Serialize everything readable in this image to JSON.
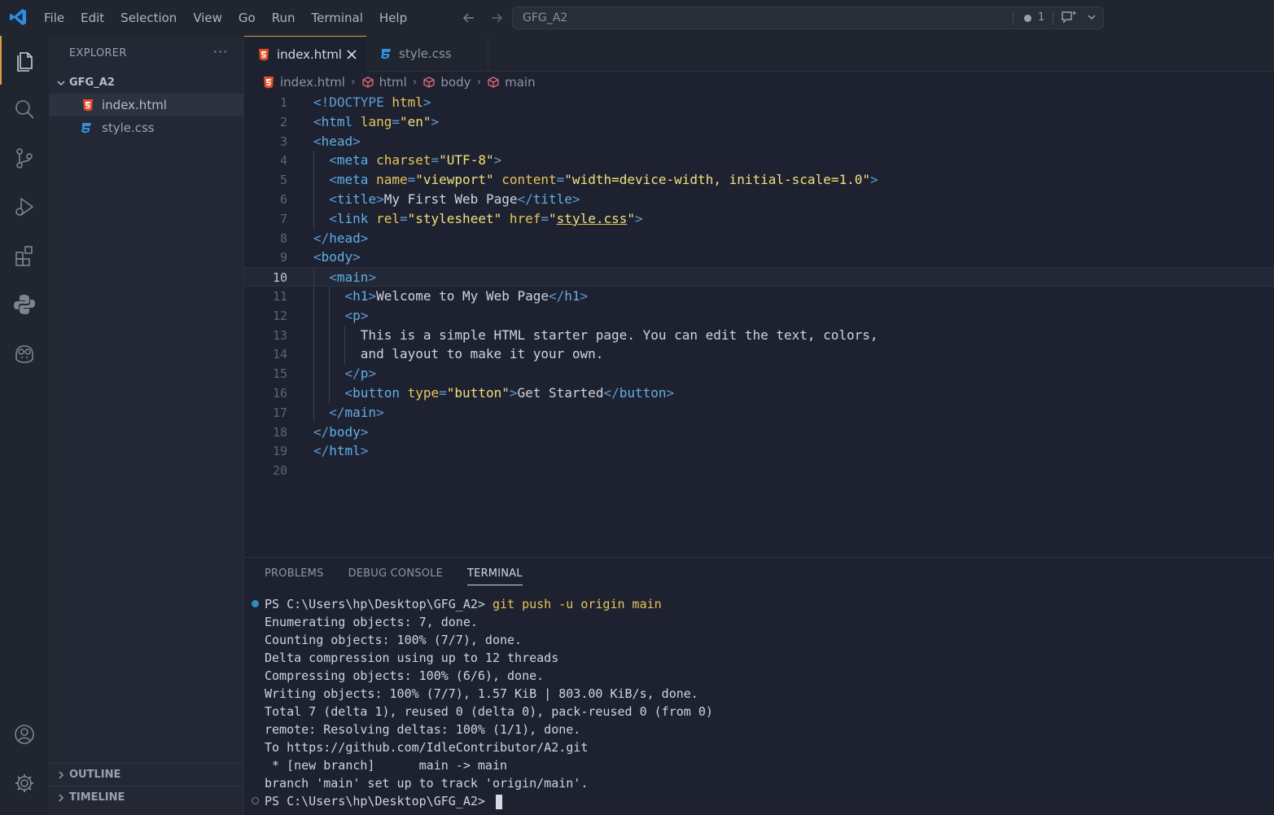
{
  "titlebar": {
    "menu": [
      "File",
      "Edit",
      "Selection",
      "View",
      "Go",
      "Run",
      "Terminal",
      "Help"
    ],
    "command_center": {
      "title": "GFG_A2",
      "problems_count": "1"
    }
  },
  "sidebar": {
    "title": "EXPLORER",
    "more": "···",
    "folder": "GFG_A2",
    "files": [
      {
        "name": "index.html",
        "icon": "html5-icon"
      },
      {
        "name": "style.css",
        "icon": "css3-icon"
      }
    ],
    "sections": [
      "OUTLINE",
      "TIMELINE"
    ]
  },
  "tabs": [
    {
      "label": "index.html",
      "icon": "html5-icon",
      "active": true
    },
    {
      "label": "style.css",
      "icon": "css3-icon",
      "active": false
    }
  ],
  "breadcrumb": [
    "index.html",
    "html",
    "body",
    "main"
  ],
  "editor": {
    "current_line": 10,
    "lines": [
      "<!DOCTYPE html>",
      "<html lang=\"en\">",
      "<head>",
      "  <meta charset=\"UTF-8\">",
      "  <meta name=\"viewport\" content=\"width=device-width, initial-scale=1.0\">",
      "  <title>My First Web Page</title>",
      "  <link rel=\"stylesheet\" href=\"style.css\">",
      "</head>",
      "<body>",
      "  <main>",
      "    <h1>Welcome to My Web Page</h1>",
      "    <p>",
      "      This is a simple HTML starter page. You can edit the text, colors,",
      "      and layout to make it your own.",
      "    </p>",
      "    <button type=\"button\">Get Started</button>",
      "  </main>",
      "</body>",
      "</html>",
      ""
    ]
  },
  "panel": {
    "tabs": [
      "PROBLEMS",
      "DEBUG CONSOLE",
      "TERMINAL"
    ],
    "active_tab": "TERMINAL",
    "terminal": {
      "prompt": "PS C:\\Users\\hp\\Desktop\\GFG_A2> ",
      "command": "git push -u origin main",
      "output": [
        "Enumerating objects: 7, done.",
        "Counting objects: 100% (7/7), done.",
        "Delta compression using up to 12 threads",
        "Compressing objects: 100% (6/6), done.",
        "Writing objects: 100% (7/7), 1.57 KiB | 803.00 KiB/s, done.",
        "Total 7 (delta 1), reused 0 (delta 0), pack-reused 0 (from 0)",
        "remote: Resolving deltas: 100% (1/1), done.",
        "To https://github.com/IdleContributor/A2.git",
        " * [new branch]      main -> main",
        "branch 'main' set up to track 'origin/main'."
      ],
      "final_prompt": "PS C:\\Users\\hp\\Desktop\\GFG_A2> "
    }
  },
  "colors": {
    "accent": "#d8a13a",
    "html_icon": "#e44d26",
    "css_icon": "#2f8fe0",
    "vscode_logo": "#2a8fe8",
    "success_dot": "#2a8fbd"
  }
}
